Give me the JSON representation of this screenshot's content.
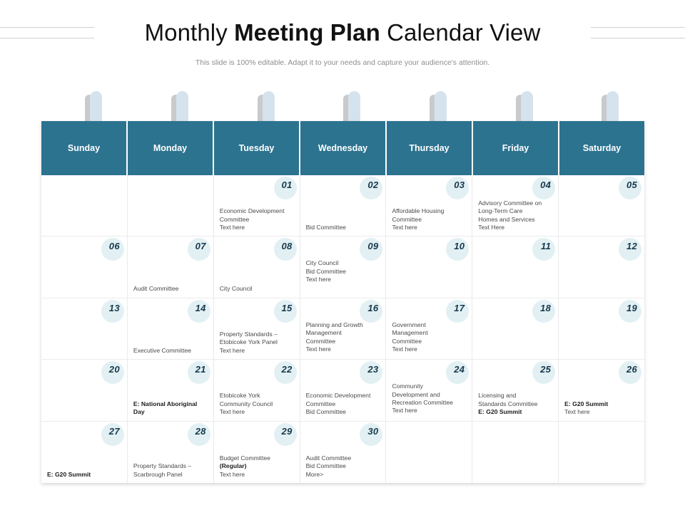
{
  "title": {
    "part1": "Monthly ",
    "part2": "Meeting Plan",
    "part3": " Calendar View",
    "full": "Monthly Meeting Plan Calendar View"
  },
  "subtitle": "This slide is 100% editable. Adapt it to your needs and capture your audience's attention.",
  "colors": {
    "header_bg": "#2c7390",
    "header_text": "#ffffff",
    "ring": "#d5e3ee",
    "ring_shadow": "#c9cacc",
    "day_number": "#16384b",
    "day_halo": "#e2f0f4",
    "body_text": "#4a4a4c",
    "cell_border": "#e9eaec",
    "title_text": "#121212",
    "subtitle_text": "#8d8d92"
  },
  "weekdays": [
    {
      "label": "Sunday"
    },
    {
      "label": "Monday"
    },
    {
      "label": "Tuesday"
    },
    {
      "label": "Wednesday"
    },
    {
      "label": "Thursday"
    },
    {
      "label": "Friday"
    },
    {
      "label": "Saturday"
    }
  ],
  "weeks": [
    {
      "days": [
        {
          "number": "",
          "align": "bottom",
          "lines": []
        },
        {
          "number": "",
          "align": "bottom",
          "lines": []
        },
        {
          "number": "01",
          "align": "bottom",
          "lines": [
            {
              "text": "Economic Development",
              "bold": false
            },
            {
              "text": "Committee",
              "bold": false
            },
            {
              "text": "Text here",
              "bold": false
            }
          ]
        },
        {
          "number": "02",
          "align": "bottom",
          "lines": [
            {
              "text": "Bid Committee",
              "bold": false
            }
          ]
        },
        {
          "number": "03",
          "align": "bottom",
          "lines": [
            {
              "text": "Affordable Housing",
              "bold": false
            },
            {
              "text": "Committee",
              "bold": false
            },
            {
              "text": "Text here",
              "bold": false
            }
          ]
        },
        {
          "number": "04",
          "align": "bottom",
          "lines": [
            {
              "text": "Advisory Committee on",
              "bold": false
            },
            {
              "text": "Long-Term Care",
              "bold": false
            },
            {
              "text": "Homes and Services",
              "bold": false
            },
            {
              "text": "Text Here",
              "bold": false
            }
          ]
        },
        {
          "number": "05",
          "align": "bottom",
          "lines": []
        }
      ]
    },
    {
      "days": [
        {
          "number": "06",
          "align": "bottom",
          "lines": []
        },
        {
          "number": "07",
          "align": "bottom",
          "lines": [
            {
              "text": "Audit Committee",
              "bold": false
            }
          ]
        },
        {
          "number": "08",
          "align": "bottom",
          "lines": [
            {
              "text": "City Council",
              "bold": false
            }
          ]
        },
        {
          "number": "09",
          "align": "top",
          "lines": [
            {
              "text": "City Council",
              "bold": false
            },
            {
              "text": "Bid Committee",
              "bold": false
            },
            {
              "text": "Text here",
              "bold": false
            }
          ]
        },
        {
          "number": "10",
          "align": "bottom",
          "lines": []
        },
        {
          "number": "11",
          "align": "bottom",
          "lines": []
        },
        {
          "number": "12",
          "align": "bottom",
          "lines": []
        }
      ]
    },
    {
      "days": [
        {
          "number": "13",
          "align": "bottom",
          "lines": []
        },
        {
          "number": "14",
          "align": "bottom",
          "lines": [
            {
              "text": "Executive Committee",
              "bold": false
            }
          ]
        },
        {
          "number": "15",
          "align": "bottom",
          "lines": [
            {
              "text": "Property Standards –",
              "bold": false
            },
            {
              "text": "Etobicoke York Panel",
              "bold": false
            },
            {
              "text": "Text here",
              "bold": false
            }
          ]
        },
        {
          "number": "16",
          "align": "top",
          "lines": [
            {
              "text": "Planning and Growth",
              "bold": false
            },
            {
              "text": "Management",
              "bold": false
            },
            {
              "text": "Committee",
              "bold": false
            },
            {
              "text": "Text here",
              "bold": false
            }
          ]
        },
        {
          "number": "17",
          "align": "top",
          "lines": [
            {
              "text": "Government",
              "bold": false
            },
            {
              "text": "Management",
              "bold": false
            },
            {
              "text": "Committee",
              "bold": false
            },
            {
              "text": "Text here",
              "bold": false
            }
          ]
        },
        {
          "number": "18",
          "align": "bottom",
          "lines": []
        },
        {
          "number": "19",
          "align": "bottom",
          "lines": []
        }
      ]
    },
    {
      "days": [
        {
          "number": "20",
          "align": "bottom",
          "lines": []
        },
        {
          "number": "21",
          "align": "bottom",
          "lines": [
            {
              "text": "E: National Aboriginal",
              "bold": true
            },
            {
              "text": "Day",
              "bold": true
            }
          ]
        },
        {
          "number": "22",
          "align": "bottom",
          "lines": [
            {
              "text": "Etobicoke York",
              "bold": false
            },
            {
              "text": "Community Council",
              "bold": false
            },
            {
              "text": "Text here",
              "bold": false
            }
          ]
        },
        {
          "number": "23",
          "align": "bottom",
          "lines": [
            {
              "text": "Economic Development",
              "bold": false
            },
            {
              "text": "Committee",
              "bold": false
            },
            {
              "text": "Bid Committee",
              "bold": false
            }
          ]
        },
        {
          "number": "24",
          "align": "top",
          "lines": [
            {
              "text": "Community",
              "bold": false
            },
            {
              "text": "Development and",
              "bold": false
            },
            {
              "text": "Recreation Committee",
              "bold": false
            },
            {
              "text": "Text here",
              "bold": false
            }
          ]
        },
        {
          "number": "25",
          "align": "bottom",
          "lines": [
            {
              "text": "Licensing and",
              "bold": false
            },
            {
              "text": "Standards Committee",
              "bold": false
            },
            {
              "text": "E: G20 Summit",
              "bold": true
            }
          ]
        },
        {
          "number": "26",
          "align": "bottom",
          "lines": [
            {
              "text": "E: G20 Summit",
              "bold": true
            },
            {
              "text": "Text here",
              "bold": false
            }
          ]
        }
      ]
    },
    {
      "days": [
        {
          "number": "27",
          "align": "bottom",
          "lines": [
            {
              "text": "E: G20 Summit",
              "bold": true
            }
          ]
        },
        {
          "number": "28",
          "align": "bottom",
          "lines": [
            {
              "text": "Property Standards –",
              "bold": false
            },
            {
              "text": "Scarbrough Panel",
              "bold": false
            }
          ]
        },
        {
          "number": "29",
          "align": "bottom",
          "lines": [
            {
              "text": "Budget Committee",
              "bold": false
            },
            {
              "text": "(Regular)",
              "bold": true
            },
            {
              "text": "Text here",
              "bold": false
            }
          ]
        },
        {
          "number": "30",
          "align": "bottom",
          "lines": [
            {
              "text": "Audit Committee",
              "bold": false
            },
            {
              "text": "Bid Committee",
              "bold": false
            },
            {
              "text": "More>",
              "bold": false
            }
          ]
        },
        {
          "number": "",
          "align": "bottom",
          "lines": []
        },
        {
          "number": "",
          "align": "bottom",
          "lines": []
        },
        {
          "number": "",
          "align": "bottom",
          "lines": []
        }
      ]
    }
  ]
}
